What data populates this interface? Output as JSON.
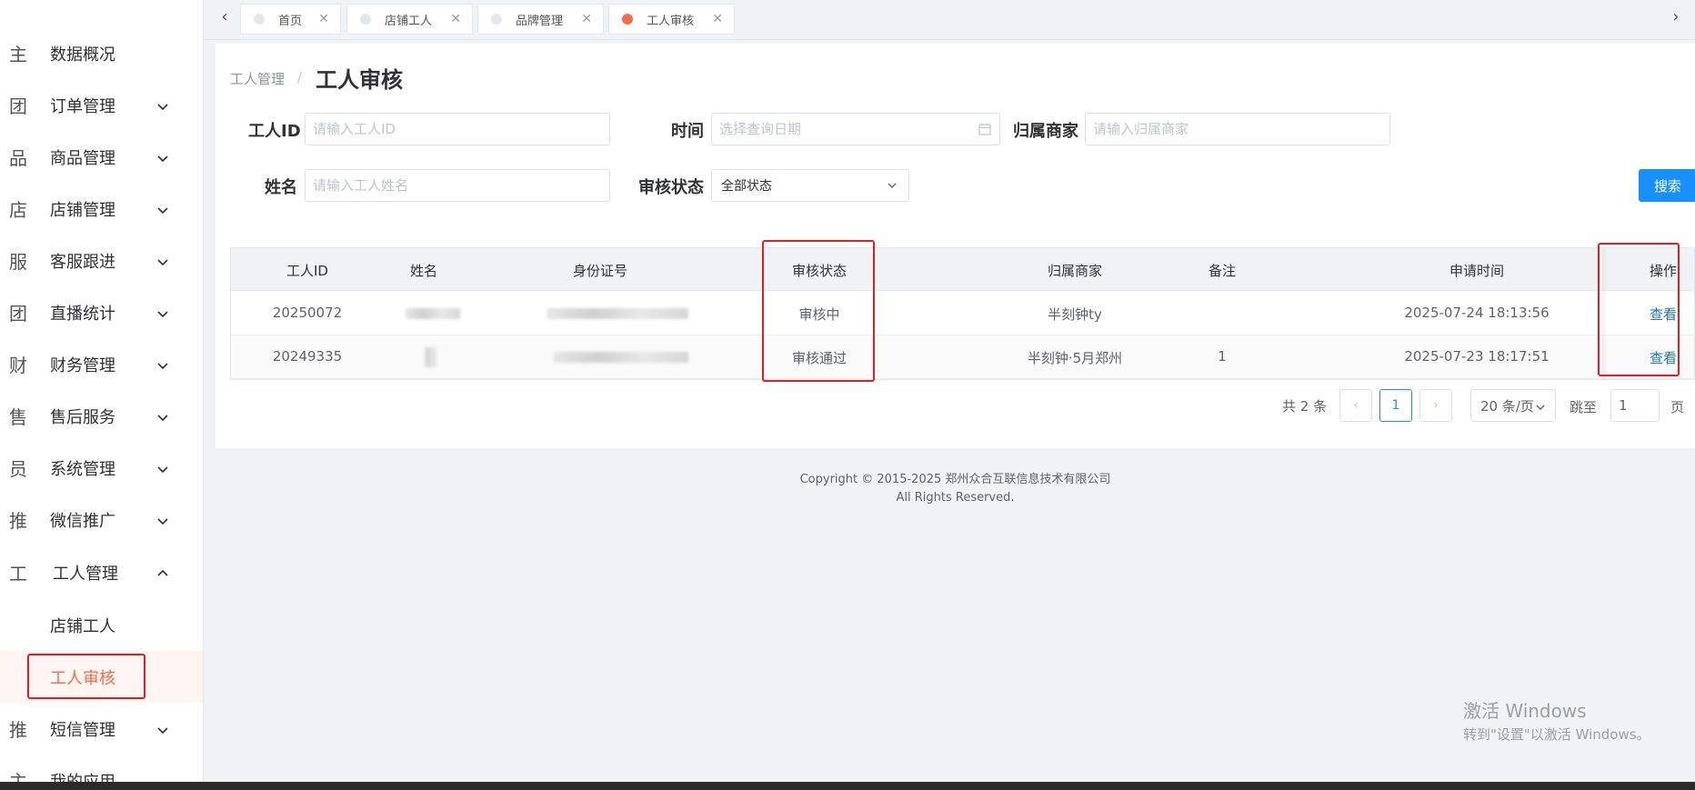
{
  "sidebar": {
    "items": [
      {
        "icon": "主",
        "label": "数据概况",
        "has_arrow": false
      },
      {
        "icon": "团",
        "label": "订单管理",
        "has_arrow": true
      },
      {
        "icon": "品",
        "label": "商品管理",
        "has_arrow": true
      },
      {
        "icon": "店",
        "label": "店铺管理",
        "has_arrow": true
      },
      {
        "icon": "服",
        "label": "客服跟进",
        "has_arrow": true
      },
      {
        "icon": "团",
        "label": "直播统计",
        "has_arrow": true
      },
      {
        "icon": "财",
        "label": "财务管理",
        "has_arrow": true
      },
      {
        "icon": "售",
        "label": "售后服务",
        "has_arrow": true
      },
      {
        "icon": "员",
        "label": "系统管理",
        "has_arrow": true
      },
      {
        "icon": "推",
        "label": "微信推广",
        "has_arrow": true
      },
      {
        "icon": "工",
        "label": "工人管理",
        "has_arrow": true,
        "expanded": true
      },
      {
        "icon": "推",
        "label": "短信管理",
        "has_arrow": true
      },
      {
        "icon": "主",
        "label": "我的应用",
        "has_arrow": false
      }
    ],
    "sub_items": [
      {
        "label": "店铺工人",
        "active": false
      },
      {
        "label": "工人审核",
        "active": true
      }
    ]
  },
  "tabs": [
    {
      "label": "首页",
      "active": false
    },
    {
      "label": "店铺工人",
      "active": false
    },
    {
      "label": "品牌管理",
      "active": false
    },
    {
      "label": "工人审核",
      "active": true
    }
  ],
  "breadcrumb": {
    "parent": "工人管理",
    "separator": "/"
  },
  "page_title": "工人审核",
  "filters": {
    "worker_id": {
      "label": "工人ID",
      "placeholder": "请输入工人ID",
      "value": ""
    },
    "time": {
      "label": "时间",
      "placeholder": "选择查询日期",
      "value": ""
    },
    "merchant": {
      "label": "归属商家",
      "placeholder": "请输入归属商家",
      "value": ""
    },
    "name": {
      "label": "姓名",
      "placeholder": "请输入工人姓名",
      "value": ""
    },
    "status": {
      "label": "审核状态",
      "selected": "全部状态"
    },
    "search_label": "搜索"
  },
  "table": {
    "headers": [
      "工人ID",
      "姓名",
      "身份证号",
      "审核状态",
      "归属商家",
      "备注",
      "申请时间",
      "操作"
    ],
    "rows": [
      {
        "id": "20250072",
        "status": "审核中",
        "merchant": "半刻钟ty",
        "remark": "",
        "time": "2025-07-24 18:13:56",
        "action": "查看"
      },
      {
        "id": "20249335",
        "status": "审核通过",
        "merchant": "半刻钟·5月郑州",
        "remark": "1",
        "time": "2025-07-23 18:17:51",
        "action": "查看"
      }
    ]
  },
  "pagination": {
    "total_text": "共 2 条",
    "prev": "‹",
    "current_page": "1",
    "next": "›",
    "page_size": "20 条/页",
    "jump_label": "跳至",
    "jump_value": "1",
    "page_suffix": "页"
  },
  "footer": {
    "line1": "Copyright © 2015-2025 郑州众合互联信息技术有限公司",
    "line2": "All Rights Reserved."
  },
  "watermark": {
    "line1": "激活 Windows",
    "line2": "转到\"设置\"以激活 Windows。"
  },
  "colors": {
    "accent": "#1890ff",
    "active_menu": "#f56c47",
    "highlight_box": "#e02020",
    "link": "#1677d2"
  }
}
